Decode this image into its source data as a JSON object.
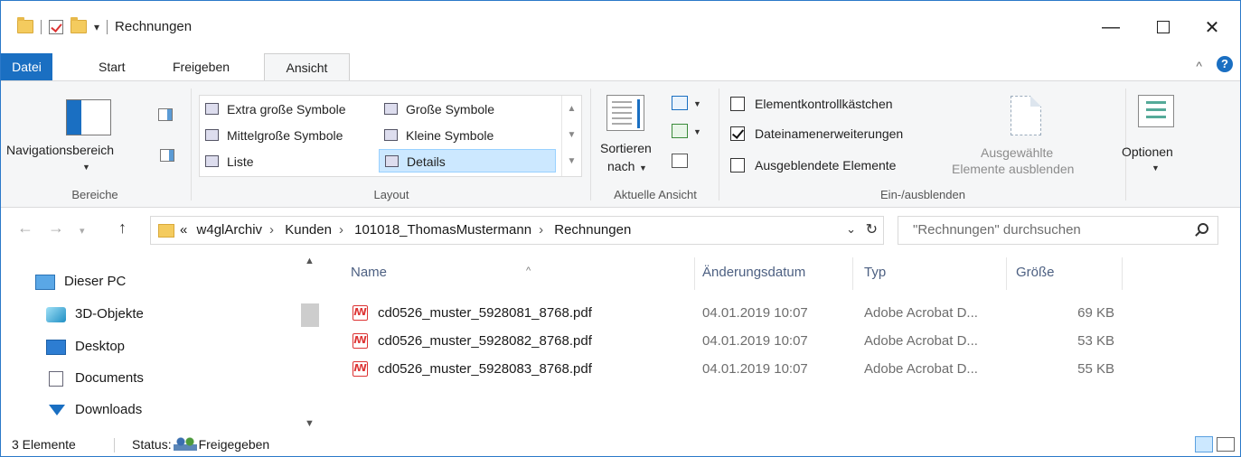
{
  "window": {
    "title": "Rechnungen",
    "qat_dropdown": "▾",
    "min_glyph": "—",
    "close_glyph": "✕"
  },
  "tabs": {
    "file": "Datei",
    "start": "Start",
    "share": "Freigeben",
    "view": "Ansicht"
  },
  "ribbon": {
    "help_glyph": "?",
    "collapse_glyph": "^",
    "panes": {
      "nav_label": "Navigationsbereich",
      "group_label": "Bereiche"
    },
    "layout": {
      "group_label": "Layout",
      "items": [
        "Extra große Symbole",
        "Große Symbole",
        "Mittelgroße Symbole",
        "Kleine Symbole",
        "Liste",
        "Details"
      ],
      "selected": "Details"
    },
    "current_view": {
      "sort_label_1": "Sortieren",
      "sort_label_2": "nach",
      "group_label": "Aktuelle Ansicht"
    },
    "show_hide": {
      "item_checkboxes": "Elementkontrollkästchen",
      "item_checkboxes_checked": false,
      "file_extensions": "Dateinamenerweiterungen",
      "file_extensions_checked": true,
      "hidden_items": "Ausgeblendete Elemente",
      "hidden_items_checked": false,
      "hide_selected_1": "Ausgewählte",
      "hide_selected_2": "Elemente ausblenden",
      "group_label": "Ein-/ausblenden"
    },
    "options_label": "Optionen"
  },
  "address": {
    "prefix": "«",
    "crumbs": [
      "w4glArchiv",
      "Kunden",
      "101018_ThomasMustermann",
      "Rechnungen"
    ],
    "search_placeholder": "\"Rechnungen\" durchsuchen"
  },
  "sidebar": {
    "items": [
      {
        "label": "Dieser PC",
        "icon": "computer-icon"
      },
      {
        "label": "3D-Objekte",
        "icon": "cube-icon"
      },
      {
        "label": "Desktop",
        "icon": "desktop-icon"
      },
      {
        "label": "Documents",
        "icon": "documents-icon"
      },
      {
        "label": "Downloads",
        "icon": "download-arrow-icon"
      }
    ]
  },
  "files": {
    "columns": {
      "name": "Name",
      "date": "Änderungsdatum",
      "type": "Typ",
      "size": "Größe"
    },
    "rows": [
      {
        "name": "cd0526_muster_5928081_8768.pdf",
        "date": "04.01.2019 10:07",
        "type": "Adobe Acrobat D...",
        "size": "69 KB"
      },
      {
        "name": "cd0526_muster_5928082_8768.pdf",
        "date": "04.01.2019 10:07",
        "type": "Adobe Acrobat D...",
        "size": "53 KB"
      },
      {
        "name": "cd0526_muster_5928083_8768.pdf",
        "date": "04.01.2019 10:07",
        "type": "Adobe Acrobat D...",
        "size": "55 KB"
      }
    ]
  },
  "status": {
    "count": "3 Elemente",
    "status_label": "Status:",
    "status_value": "Freigegeben"
  },
  "colors": {
    "accent": "#1a6fc2",
    "ribbon_bg": "#f5f6f7",
    "selection": "#cce8ff"
  }
}
